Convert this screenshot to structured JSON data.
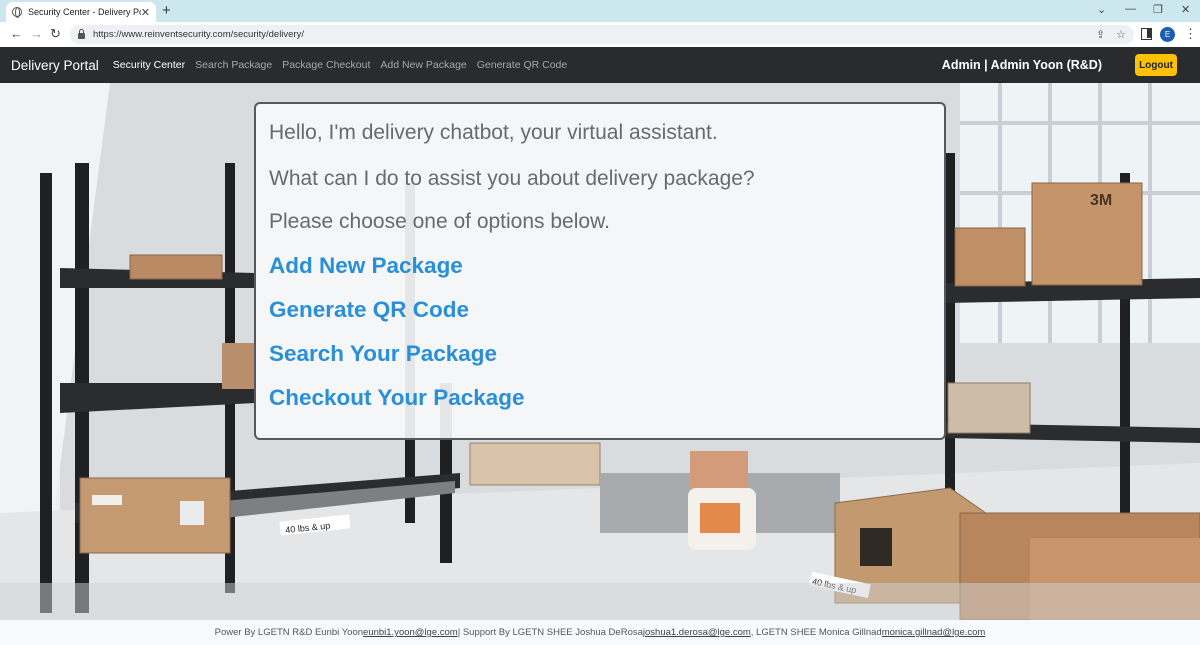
{
  "browser": {
    "tab_title": "Security Center - Delivery Portal",
    "tab_close": "✕",
    "new_tab": "+",
    "url": "https://www.reinventsecurity.com/security/delivery/",
    "profile_initial": "E",
    "window_controls": [
      "⌄",
      "—",
      "❐",
      "✕"
    ],
    "nav_icons": [
      "back-arrow-icon",
      "forward-arrow-icon",
      "reload-icon"
    ]
  },
  "nav": {
    "brand": "Delivery Portal",
    "links": [
      {
        "label": "Security Center",
        "active": true
      },
      {
        "label": "Search Package",
        "active": false
      },
      {
        "label": "Package Checkout",
        "active": false
      },
      {
        "label": "Add New Package",
        "active": false
      },
      {
        "label": "Generate QR Code",
        "active": false
      }
    ],
    "user": "Admin | Admin Yoon (R&D)",
    "logout_label": "Logout",
    "logout_color": "#ffc107"
  },
  "chat": {
    "greeting": "Hello, I'm delivery chatbot, your virtual assistant.",
    "question": "What can I do to assist you about delivery package?",
    "instruction": "Please choose one of options below.",
    "options": [
      "Add New Package",
      "Generate QR Code",
      "Search Your Package",
      "Checkout Your Package"
    ],
    "option_color": "#2a8fd6"
  },
  "background": {
    "shelf_labels": [
      "40 lbs & up",
      "40 lbs & up"
    ],
    "box_brand": "3M"
  },
  "footer": {
    "part1": "Power By LGETN R&D Eunbi Yoon ",
    "email1": "eunbi1.yoon@lge.com",
    "part2": " | Support By LGETN SHEE Joshua DeRosa ",
    "email2": "joshua1.derosa@lge.com",
    "part3": ", LGETN SHEE Monica Gillnad ",
    "email3": "monica.gillnad@lge.com"
  }
}
